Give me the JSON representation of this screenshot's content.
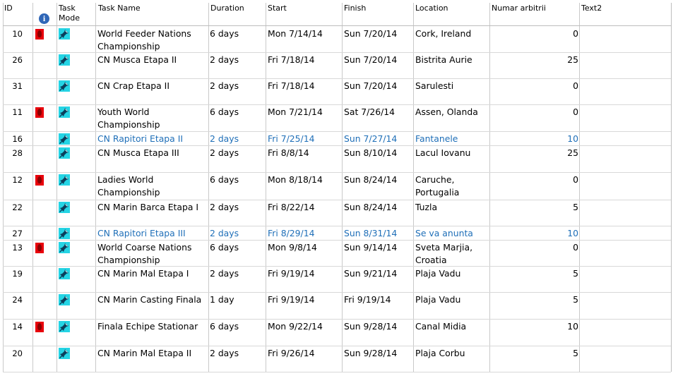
{
  "headers": {
    "id": "ID",
    "info": "i",
    "task_mode": "Task\nMode",
    "task_name": "Task Name",
    "duration": "Duration",
    "start": "Start",
    "finish": "Finish",
    "location": "Location",
    "numar_arbitrii": "Numar arbitrii",
    "text2": "Text2"
  },
  "colors": {
    "highlight_row": "#1f6fb8",
    "indicator": "#e8000b",
    "task_mode_icon": "#25d4e4",
    "info_icon": "#2f66b7"
  },
  "rows": [
    {
      "id": "10",
      "indicator": true,
      "name": "World Feeder Nations\nChampionship",
      "duration": "6 days",
      "start": "Mon 7/14/14",
      "finish": "Sun 7/20/14",
      "location": "Cork, Ireland",
      "numar": "0",
      "highlight": false
    },
    {
      "id": "26",
      "indicator": false,
      "name": "CN Musca Etapa II",
      "duration": "2 days",
      "start": "Fri 7/18/14",
      "finish": "Sun 7/20/14",
      "location": "Bistrita Aurie",
      "numar": "25",
      "highlight": false
    },
    {
      "id": "31",
      "indicator": false,
      "name": "CN Crap Etapa II",
      "duration": "2 days",
      "start": "Fri 7/18/14",
      "finish": "Sun 7/20/14",
      "location": "Sarulesti",
      "numar": "0",
      "highlight": false
    },
    {
      "id": "11",
      "indicator": true,
      "name": "Youth World\nChampionship",
      "duration": "6 days",
      "start": "Mon 7/21/14",
      "finish": "Sat 7/26/14",
      "location": "Assen, Olanda",
      "numar": "0",
      "highlight": false
    },
    {
      "id": "16",
      "indicator": false,
      "name": "CN Rapitori Etapa II",
      "duration": "2 days",
      "start": "Fri 7/25/14",
      "finish": "Sun 7/27/14",
      "location": "Fantanele",
      "numar": "10",
      "highlight": true
    },
    {
      "id": "28",
      "indicator": false,
      "name": "CN Musca Etapa III",
      "duration": "2 days",
      "start": "Fri 8/8/14",
      "finish": "Sun 8/10/14",
      "location": "Lacul Iovanu",
      "numar": "25",
      "highlight": false
    },
    {
      "id": "12",
      "indicator": true,
      "name": "Ladies World\nChampionship",
      "duration": "6 days",
      "start": "Mon 8/18/14",
      "finish": "Sun 8/24/14",
      "location": "Caruche,\nPortugalia",
      "numar": "0",
      "highlight": false
    },
    {
      "id": "22",
      "indicator": false,
      "name": "CN Marin Barca Etapa I",
      "duration": "2 days",
      "start": "Fri 8/22/14",
      "finish": "Sun 8/24/14",
      "location": "Tuzla",
      "numar": "5",
      "highlight": false
    },
    {
      "id": "27",
      "indicator": false,
      "name": "CN Rapitori Etapa III",
      "duration": "2 days",
      "start": "Fri 8/29/14",
      "finish": "Sun 8/31/14",
      "location": "Se va anunta",
      "numar": "10",
      "highlight": true
    },
    {
      "id": "13",
      "indicator": true,
      "name": "World Coarse Nations\nChampionship",
      "duration": "6 days",
      "start": "Mon 9/8/14",
      "finish": "Sun 9/14/14",
      "location": "Sveta Marjia,\nCroatia",
      "numar": "0",
      "highlight": false
    },
    {
      "id": "19",
      "indicator": false,
      "name": "CN Marin Mal Etapa I",
      "duration": "2 days",
      "start": "Fri 9/19/14",
      "finish": "Sun 9/21/14",
      "location": "Plaja Vadu",
      "numar": "5",
      "highlight": false
    },
    {
      "id": "24",
      "indicator": false,
      "name": "CN Marin Casting Finala",
      "duration": "1 day",
      "start": "Fri 9/19/14",
      "finish": "Fri 9/19/14",
      "location": "Plaja Vadu",
      "numar": "5",
      "highlight": false
    },
    {
      "id": "14",
      "indicator": true,
      "name": "Finala Echipe Stationar",
      "duration": "6 days",
      "start": "Mon 9/22/14",
      "finish": "Sun 9/28/14",
      "location": "Canal Midia",
      "numar": "10",
      "highlight": false
    },
    {
      "id": "20",
      "indicator": false,
      "name": "CN Marin Mal Etapa II",
      "duration": "2 days",
      "start": "Fri 9/26/14",
      "finish": "Sun 9/28/14",
      "location": "Plaja Corbu",
      "numar": "5",
      "highlight": false
    }
  ]
}
